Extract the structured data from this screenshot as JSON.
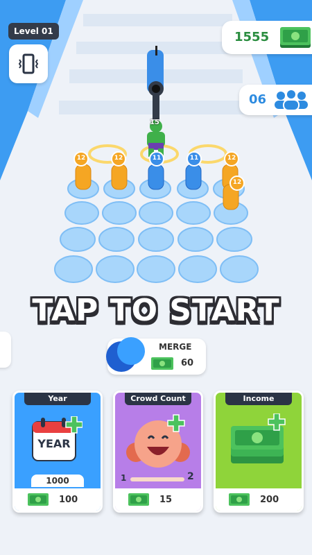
{
  "hud": {
    "level_label": "Level 01",
    "money": "1555",
    "crowd_count": "06"
  },
  "crowd_numbers": {
    "boss": "15",
    "yellow_1": "12",
    "yellow_2": "12",
    "blue_1": "11",
    "blue_2": "11",
    "yellow_3": "12",
    "yellow_4": "12"
  },
  "cta": {
    "tap_to_start": "TAP TO START"
  },
  "merge": {
    "label": "MERGE",
    "cost": "60"
  },
  "upgrades": [
    {
      "title": "Year",
      "icon_text": "YEAR",
      "value": "1000",
      "cost": "100"
    },
    {
      "title": "Crowd Count",
      "range_min": "1",
      "range_max": "2",
      "cost": "15"
    },
    {
      "title": "Income",
      "cost": "200"
    }
  ],
  "colors": {
    "money_green": "#2a8d3f",
    "crowd_blue": "#2d8be0",
    "card_year": "#3aa0ff",
    "card_crowd": "#b77ee8",
    "card_income": "#8fd43a",
    "dark": "#2b3445"
  }
}
